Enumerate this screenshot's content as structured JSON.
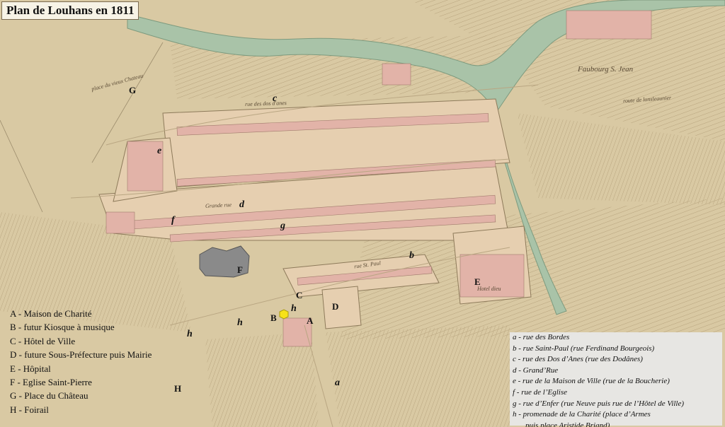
{
  "title": "Plan de Louhans en 1811",
  "markers_upper": [
    {
      "letter": "A"
    },
    {
      "letter": "B"
    },
    {
      "letter": "C"
    },
    {
      "letter": "D"
    },
    {
      "letter": "E"
    },
    {
      "letter": "F"
    },
    {
      "letter": "G"
    },
    {
      "letter": "H"
    }
  ],
  "markers_lower": [
    {
      "letter": "a"
    },
    {
      "letter": "b"
    },
    {
      "letter": "c"
    },
    {
      "letter": "d"
    },
    {
      "letter": "e"
    },
    {
      "letter": "f"
    },
    {
      "letter": "g"
    },
    {
      "letter": "h"
    },
    {
      "letter": "h"
    },
    {
      "letter": "h"
    }
  ],
  "legend_left": [
    "A - Maison de Charité",
    "B - futur Kiosque à musique",
    "C - Hôtel de Ville",
    "D - future Sous-Préfecture puis Mairie",
    "E - Hôpital",
    "F - Eglise Saint-Pierre",
    "G - Place du Château",
    "H - Foirail"
  ],
  "legend_right": [
    "a - rue des Bordes",
    "b - rue Saint-Paul (rue Ferdinand Bourgeois)",
    "c - rue des Dos d’Anes (rue des Dodânes)",
    "d  - Grand’Rue",
    "e - rue de la Maison de Ville (rue de la Boucherie)",
    "f - rue de l’Eglise",
    "g - rue d’Enfer (rue Neuve puis rue de l’Hôtel de Ville)",
    "h - promenade de la Charité (place d’Armes",
    "puis place Aristide Briand)"
  ],
  "map_labels": {
    "faubourg": "Faubourg S. Jean",
    "place_vieux_chateau": "place du vieux Chateau",
    "hotel_dieu": "Hotel dieu",
    "grande_rue": "Grande rue",
    "rue_st_paul": "rue St. Paul",
    "rue_des_dos": "rue des dos d'anes",
    "route": "route de lonsleaunier"
  },
  "colors": {
    "paper": "#d9c9a3",
    "river": "#a9c3a8",
    "building": "#e2b3a8",
    "building_dark": "#c98e86",
    "church": "#8a8a8a",
    "kiosk_marker": "#f7e21a"
  }
}
